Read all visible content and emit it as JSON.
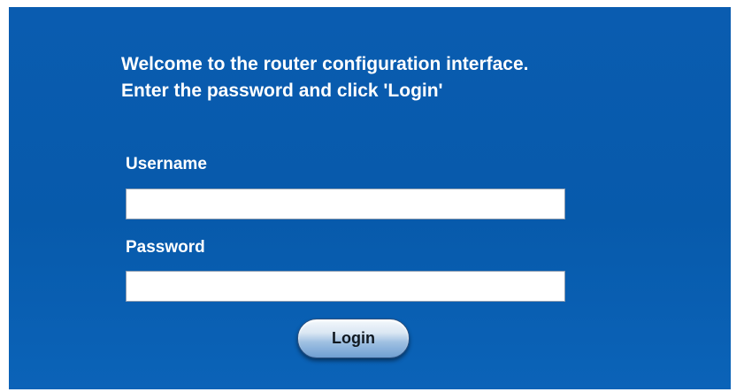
{
  "welcome": {
    "line1": "Welcome to the router configuration interface.",
    "line2": "Enter the password and click 'Login'"
  },
  "form": {
    "username_label": "Username",
    "username_value": "",
    "password_label": "Password",
    "password_value": "",
    "login_label": "Login"
  },
  "colors": {
    "panel_background": "#075aab",
    "text": "#ffffff"
  }
}
